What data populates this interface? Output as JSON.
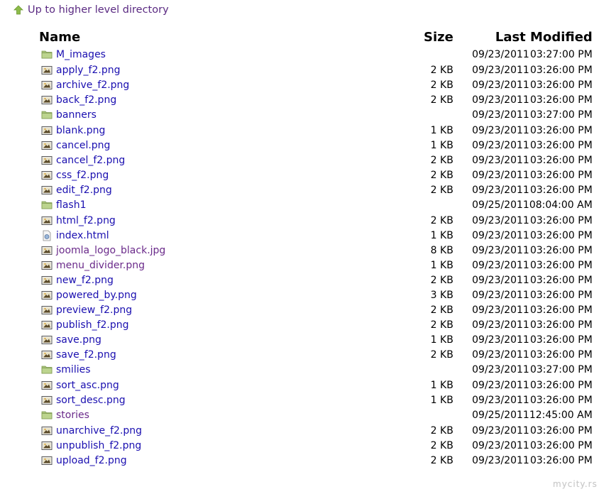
{
  "up_link": {
    "label": "Up to higher level directory"
  },
  "columns": {
    "name": "Name",
    "size": "Size",
    "modified": "Last Modified"
  },
  "entries": [
    {
      "name": "M_images",
      "type": "folder",
      "size": "",
      "date": "09/23/2011",
      "time": "03:27:00 PM"
    },
    {
      "name": "apply_f2.png",
      "type": "image",
      "size": "2 KB",
      "date": "09/23/2011",
      "time": "03:26:00 PM"
    },
    {
      "name": "archive_f2.png",
      "type": "image",
      "size": "2 KB",
      "date": "09/23/2011",
      "time": "03:26:00 PM"
    },
    {
      "name": "back_f2.png",
      "type": "image",
      "size": "2 KB",
      "date": "09/23/2011",
      "time": "03:26:00 PM"
    },
    {
      "name": "banners",
      "type": "folder",
      "size": "",
      "date": "09/23/2011",
      "time": "03:27:00 PM"
    },
    {
      "name": "blank.png",
      "type": "image",
      "size": "1 KB",
      "date": "09/23/2011",
      "time": "03:26:00 PM"
    },
    {
      "name": "cancel.png",
      "type": "image",
      "size": "1 KB",
      "date": "09/23/2011",
      "time": "03:26:00 PM"
    },
    {
      "name": "cancel_f2.png",
      "type": "image",
      "size": "2 KB",
      "date": "09/23/2011",
      "time": "03:26:00 PM"
    },
    {
      "name": "css_f2.png",
      "type": "image",
      "size": "2 KB",
      "date": "09/23/2011",
      "time": "03:26:00 PM"
    },
    {
      "name": "edit_f2.png",
      "type": "image",
      "size": "2 KB",
      "date": "09/23/2011",
      "time": "03:26:00 PM"
    },
    {
      "name": "flash1",
      "type": "folder",
      "size": "",
      "date": "09/25/2011",
      "time": "08:04:00 AM"
    },
    {
      "name": "html_f2.png",
      "type": "image",
      "size": "2 KB",
      "date": "09/23/2011",
      "time": "03:26:00 PM"
    },
    {
      "name": "index.html",
      "type": "html",
      "size": "1 KB",
      "date": "09/23/2011",
      "time": "03:26:00 PM"
    },
    {
      "name": "joomla_logo_black.jpg",
      "type": "image",
      "size": "8 KB",
      "date": "09/23/2011",
      "time": "03:26:00 PM",
      "visited": true
    },
    {
      "name": "menu_divider.png",
      "type": "image",
      "size": "1 KB",
      "date": "09/23/2011",
      "time": "03:26:00 PM",
      "visited": true
    },
    {
      "name": "new_f2.png",
      "type": "image",
      "size": "2 KB",
      "date": "09/23/2011",
      "time": "03:26:00 PM"
    },
    {
      "name": "powered_by.png",
      "type": "image",
      "size": "3 KB",
      "date": "09/23/2011",
      "time": "03:26:00 PM"
    },
    {
      "name": "preview_f2.png",
      "type": "image",
      "size": "2 KB",
      "date": "09/23/2011",
      "time": "03:26:00 PM"
    },
    {
      "name": "publish_f2.png",
      "type": "image",
      "size": "2 KB",
      "date": "09/23/2011",
      "time": "03:26:00 PM"
    },
    {
      "name": "save.png",
      "type": "image",
      "size": "1 KB",
      "date": "09/23/2011",
      "time": "03:26:00 PM"
    },
    {
      "name": "save_f2.png",
      "type": "image",
      "size": "2 KB",
      "date": "09/23/2011",
      "time": "03:26:00 PM"
    },
    {
      "name": "smilies",
      "type": "folder",
      "size": "",
      "date": "09/23/2011",
      "time": "03:27:00 PM"
    },
    {
      "name": "sort_asc.png",
      "type": "image",
      "size": "1 KB",
      "date": "09/23/2011",
      "time": "03:26:00 PM"
    },
    {
      "name": "sort_desc.png",
      "type": "image",
      "size": "1 KB",
      "date": "09/23/2011",
      "time": "03:26:00 PM"
    },
    {
      "name": "stories",
      "type": "folder",
      "size": "",
      "date": "09/25/2011",
      "time": "12:45:00 AM",
      "visited": true
    },
    {
      "name": "unarchive_f2.png",
      "type": "image",
      "size": "2 KB",
      "date": "09/23/2011",
      "time": "03:26:00 PM"
    },
    {
      "name": "unpublish_f2.png",
      "type": "image",
      "size": "2 KB",
      "date": "09/23/2011",
      "time": "03:26:00 PM"
    },
    {
      "name": "upload_f2.png",
      "type": "image",
      "size": "2 KB",
      "date": "09/23/2011",
      "time": "03:26:00 PM"
    }
  ],
  "footer": {
    "text": "mycity.rs"
  },
  "colors": {
    "link": "#1a0fb0",
    "visited": "#6a2a8a",
    "folder": "#9cb866",
    "up_arrow": "#8dbb4a"
  }
}
